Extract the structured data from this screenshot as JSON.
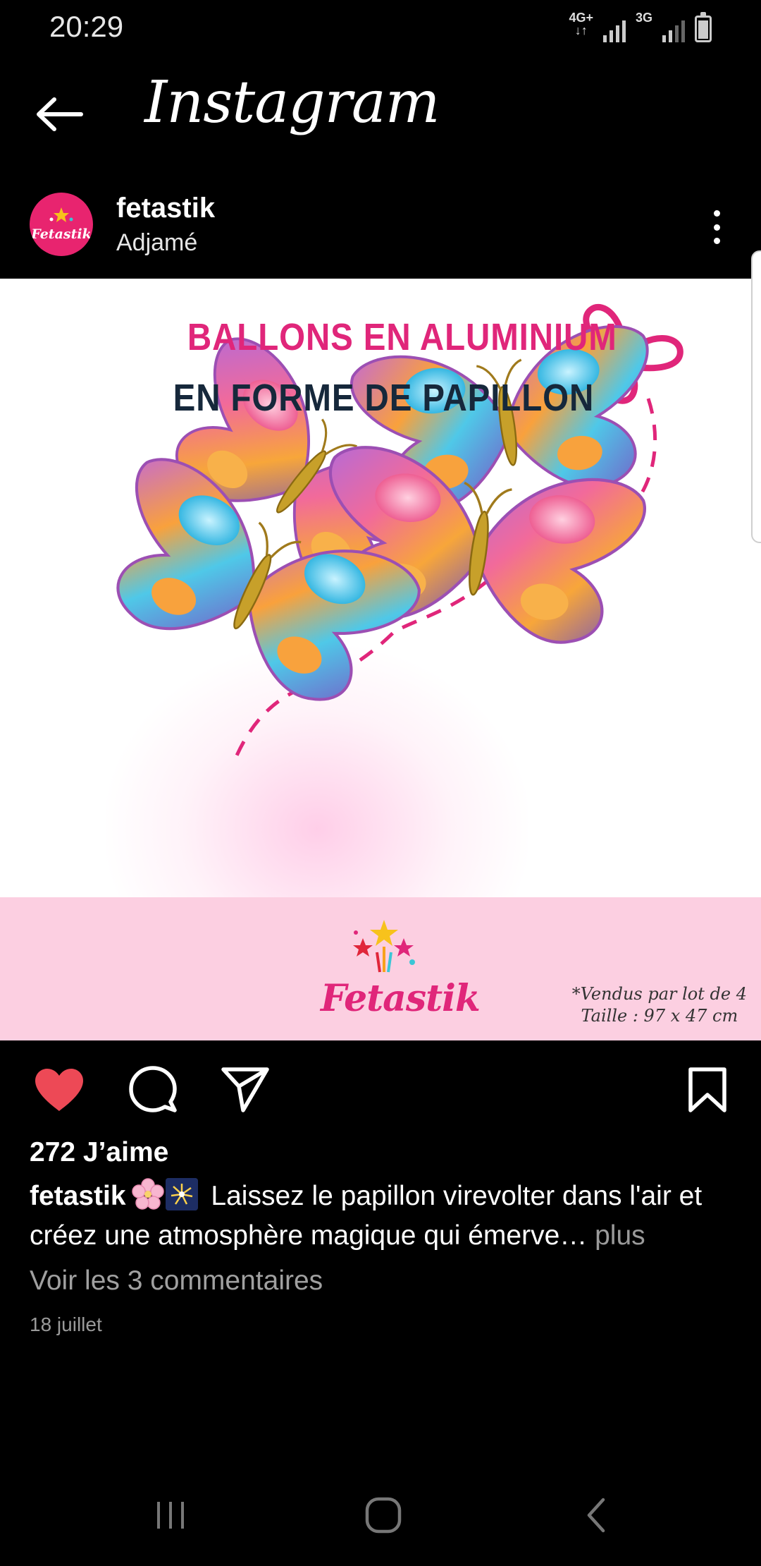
{
  "status_bar": {
    "time": "20:29",
    "network_1": "4G+",
    "network_2": "3G",
    "arrows": "↓↑"
  },
  "header": {
    "app_title": "Instagram",
    "back_icon": "arrow-left-icon"
  },
  "post": {
    "username": "fetastik",
    "location": "Adjamé",
    "avatar_text": "Fetastik",
    "image": {
      "title_line_1": "BALLONS EN ALUMINIUM",
      "title_line_2": "EN FORME DE PAPILLON",
      "brand": "Fetastik",
      "note_line_1": "*Vendus par lot de 4",
      "note_line_2": "Taille : 97 x 47 cm",
      "colors": {
        "pink": "#e0267a",
        "navy": "#16283b",
        "band": "#fccfe1"
      }
    },
    "liked": true,
    "likes_text": "272 J’aime",
    "caption_user": "fetastik",
    "caption_text": " Laissez le papillon virevolter dans l'air et créez une atmosphère magique qui émerve…",
    "caption_more": " plus",
    "view_comments": "Voir les 3 commentaires",
    "date": "18 juillet",
    "icons": [
      "heart-icon",
      "comment-icon",
      "send-icon",
      "bookmark-icon",
      "more-vertical-icon"
    ]
  },
  "colors": {
    "background": "#000000",
    "like_red": "#ed4956",
    "muted_text": "#a0a0a0"
  }
}
